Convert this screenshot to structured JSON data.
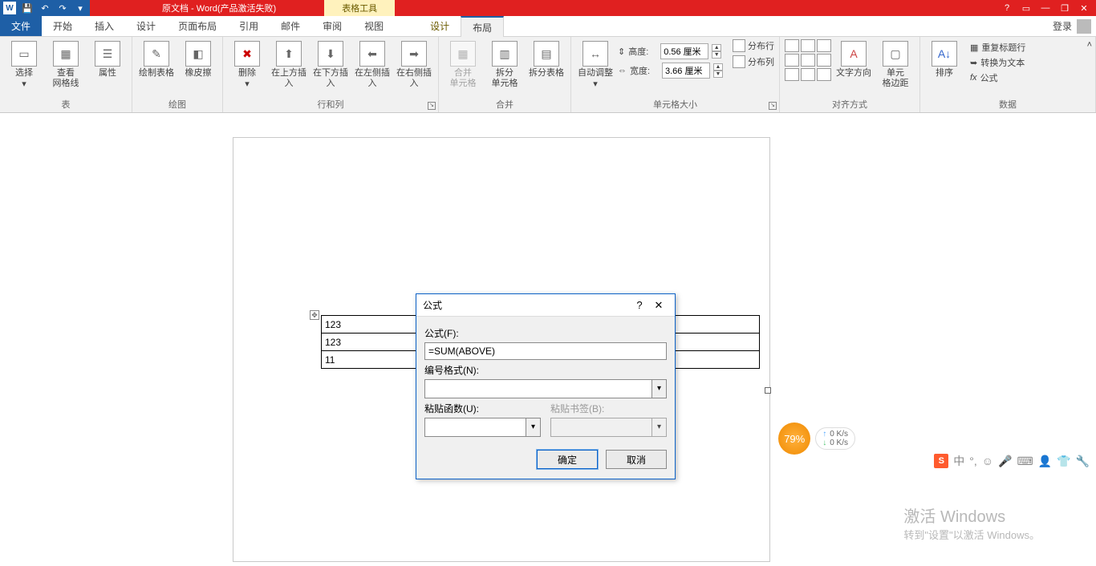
{
  "titlebar": {
    "doc_title": "原文档 - Word(产品激活失败)",
    "tool_tab": "表格工具",
    "help": "?"
  },
  "qat": {
    "word_glyph": "W"
  },
  "menu": {
    "file": "文件",
    "tabs": [
      "开始",
      "插入",
      "设计",
      "页面布局",
      "引用",
      "邮件",
      "审阅",
      "视图"
    ],
    "sub_tabs": [
      "设计",
      "布局"
    ],
    "active": "布局",
    "login": "登录"
  },
  "ribbon": {
    "group_table": {
      "label": "表",
      "select": "选择",
      "gridlines": "查看\n网格线",
      "props": "属性"
    },
    "group_draw": {
      "label": "绘图",
      "draw": "绘制表格",
      "eraser": "橡皮擦"
    },
    "group_rowscols": {
      "label": "行和列",
      "delete": "删除",
      "ins_above": "在上方插入",
      "ins_below": "在下方插入",
      "ins_left": "在左侧插入",
      "ins_right": "在右侧插入"
    },
    "group_merge": {
      "label": "合并",
      "merge": "合并\n单元格",
      "split": "拆分\n单元格",
      "split_tbl": "拆分表格"
    },
    "group_cellsize": {
      "label": "单元格大小",
      "autofit": "自动调整",
      "height_lbl": "高度:",
      "height_val": "0.56 厘米",
      "width_lbl": "宽度:",
      "width_val": "3.66 厘米",
      "dist_rows": "分布行",
      "dist_cols": "分布列"
    },
    "group_align": {
      "label": "对齐方式",
      "textdir": "文字方向",
      "margins": "单元\n格边距"
    },
    "group_data": {
      "label": "数据",
      "sort": "排序",
      "repeat": "重复标题行",
      "to_text": "转换为文本",
      "formula": "公式"
    }
  },
  "table": {
    "r1": "123",
    "r2": "123",
    "r3": "11"
  },
  "dialog": {
    "title": "公式",
    "lbl_formula": "公式(F):",
    "formula_val": "=SUM(ABOVE)",
    "lbl_numfmt": "编号格式(N):",
    "lbl_pastefn": "粘贴函数(U):",
    "lbl_pastebm": "粘贴书签(B):",
    "ok": "确定",
    "cancel": "取消"
  },
  "speed": {
    "pct": "79%",
    "up": "0 K/s",
    "down": "0 K/s"
  },
  "ime": {
    "s": "S",
    "cn": "中"
  },
  "activate": {
    "big": "激活 Windows",
    "small": "转到\"设置\"以激活 Windows。"
  }
}
